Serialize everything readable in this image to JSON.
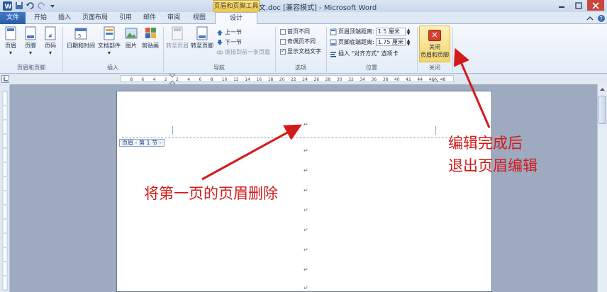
{
  "window": {
    "title": "优美的散文.doc [兼容模式] - Microsoft Word",
    "context_tab_header": "页眉和页脚工具"
  },
  "tabs": [
    "文件",
    "开始",
    "插入",
    "页面布局",
    "引用",
    "邮件",
    "审阅",
    "视图",
    "设计"
  ],
  "ribbon": {
    "group1": {
      "label": "页眉和页脚",
      "buttons": [
        "页眉",
        "页脚",
        "页码"
      ]
    },
    "group2": {
      "label": "插入",
      "buttons": [
        "日期和时间",
        "文档部件",
        "图片",
        "剪贴画"
      ]
    },
    "group3": {
      "label": "导航",
      "big": [
        "转至页眉",
        "转至页脚"
      ],
      "small": [
        "上一节",
        "下一节",
        "链接到前一条页眉"
      ]
    },
    "group4": {
      "label": "选项",
      "checks": [
        {
          "label": "首页不同",
          "checked": false
        },
        {
          "label": "奇偶页不同",
          "checked": false
        },
        {
          "label": "显示文档文字",
          "checked": true
        }
      ]
    },
    "group5": {
      "label": "位置",
      "header_dist_label": "页眉顶端距离:",
      "header_dist_value": "1.5 厘米",
      "footer_dist_label": "页脚底端距离:",
      "footer_dist_value": "1.75 厘米",
      "align_tab": "插入 \"对齐方式\" 选项卡"
    },
    "group6": {
      "label": "关闭",
      "close_label1": "关闭",
      "close_label2": "页眉和页脚"
    }
  },
  "ruler_ticks": [
    "8",
    "6",
    "4",
    "2",
    "2",
    "4",
    "6",
    "8",
    "10",
    "12",
    "14",
    "16",
    "18",
    "20",
    "22",
    "24",
    "26",
    "28",
    "30",
    "32",
    "34",
    "36",
    "38",
    "40",
    "42",
    "44",
    "46",
    "48"
  ],
  "document": {
    "header_tag": "页眉 - 第 1 节 -",
    "para_mark": "↵"
  },
  "annotations": {
    "delete_header": "将第一页的页眉删除",
    "exit_line1": "编辑完成后",
    "exit_line2": "退出页眉编辑"
  },
  "colors": {
    "annotation": "#d31a1a",
    "file_tab": "#2a5ea6",
    "context_tab": "#e9c64d"
  }
}
